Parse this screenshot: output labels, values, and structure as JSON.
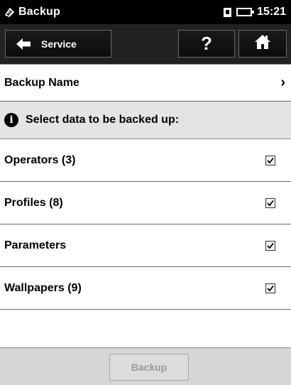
{
  "status_bar": {
    "app_icon": "backup-app-icon",
    "title": "Backup",
    "sd_icon": "sd-card-icon",
    "battery_icon": "battery-icon",
    "time": "15:21"
  },
  "toolbar": {
    "back_label": "Service",
    "back_icon": "arrow-left-icon",
    "help_label": "?",
    "home_icon": "home-icon"
  },
  "backup_name": {
    "label": "Backup Name",
    "chevron": "›"
  },
  "section": {
    "info_glyph": "i",
    "label": "Select data to be backed up:"
  },
  "items": [
    {
      "label": "Operators (3)",
      "checked": true
    },
    {
      "label": "Profiles (8)",
      "checked": true
    },
    {
      "label": "Parameters",
      "checked": true
    },
    {
      "label": "Wallpapers (9)",
      "checked": true
    }
  ],
  "footer": {
    "backup_label": "Backup",
    "backup_enabled": false
  }
}
